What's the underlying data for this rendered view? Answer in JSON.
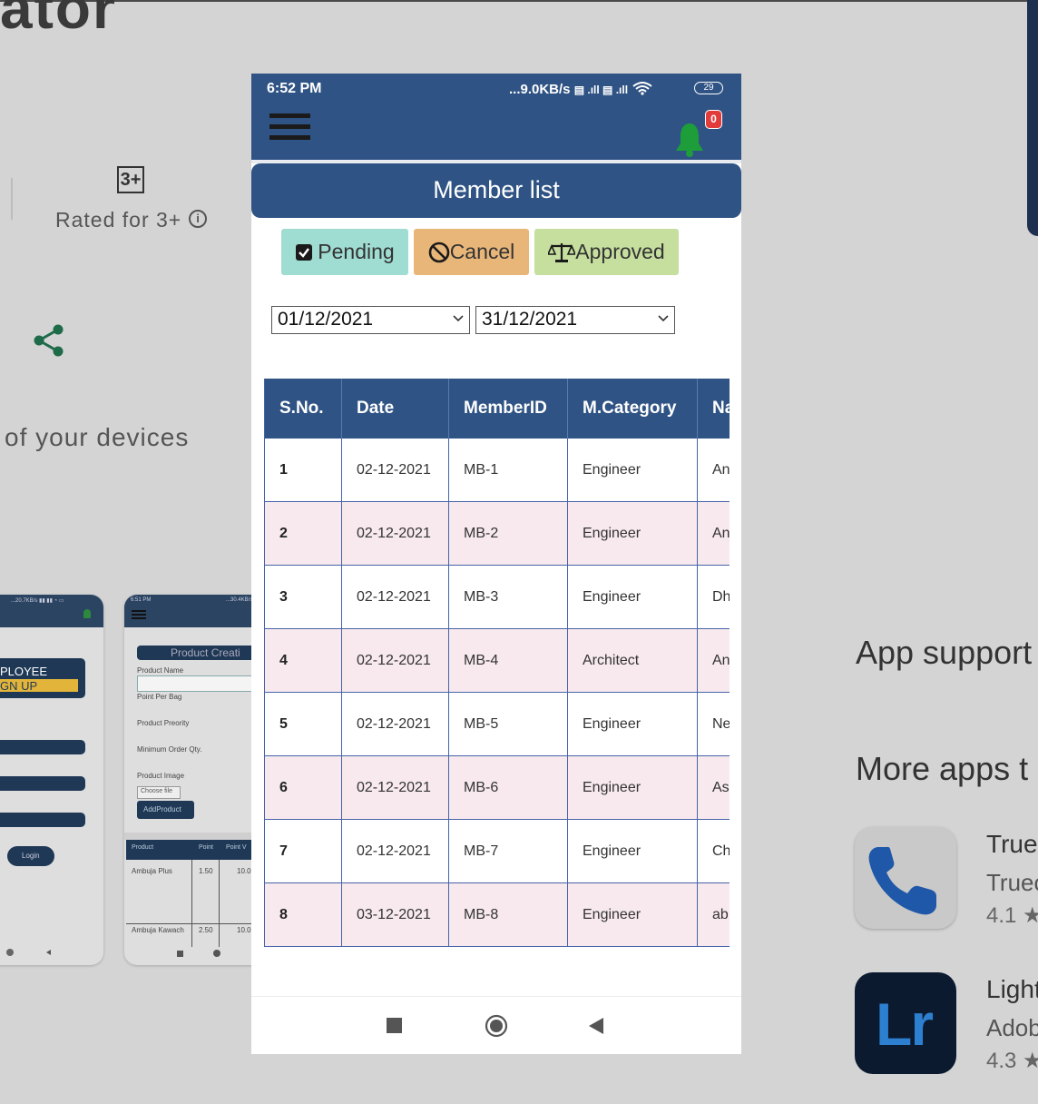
{
  "background": {
    "title_fragment": "ator",
    "rating_box": "3+",
    "rated_for": "Rated for 3+",
    "devices_text": "of your devices",
    "app_support": "App support",
    "more_apps": "More apps t",
    "apps": [
      {
        "name": "Truec",
        "developer": "Truec",
        "rating": "4.1 ★"
      },
      {
        "name": "Light",
        "developer": "Adob",
        "rating": "4.3 ★",
        "icon_text": "Lr"
      }
    ],
    "mini1": {
      "status": "...20.7KB/s ▮▮ ▮▮ ◔ ▭",
      "labels": [
        "PLOYEE",
        "GN UP",
        "Login"
      ]
    },
    "mini2": {
      "time": "6:51 PM",
      "status": "...30.4KB/s",
      "title": "Product Creati",
      "fields": [
        "Product Name",
        "Point Per Bag",
        "Product Preority",
        "Minimum Order Qty.",
        "Product Image"
      ],
      "choose_file": "Choose file",
      "add_button": "AddProduct",
      "table_headers": [
        "Product",
        "Point",
        "Point V"
      ],
      "rows": [
        [
          "Ambuja Plus",
          "1.50",
          "10.0"
        ],
        [
          "Ambuja Kawach",
          "2.50",
          "10.0"
        ]
      ]
    }
  },
  "status_bar": {
    "time": "6:52 PM",
    "network": "...9.0KB/s",
    "signal_icons": "▤ .ıll ▤ .ıll",
    "battery": "29"
  },
  "app_bar": {
    "notification_count": "0"
  },
  "page": {
    "title": "Member list"
  },
  "filters": {
    "pending": "Pending",
    "cancel": "Cancel",
    "approved": "Approved",
    "date_from": "01/12/2021",
    "date_to": "31/12/2021"
  },
  "table": {
    "headers": [
      "S.No.",
      "Date",
      "MemberID",
      "M.Category",
      "Na"
    ],
    "rows": [
      [
        "1",
        "02-12-2021",
        "MB-1",
        "Engineer",
        "An"
      ],
      [
        "2",
        "02-12-2021",
        "MB-2",
        "Engineer",
        "An"
      ],
      [
        "3",
        "02-12-2021",
        "MB-3",
        "Engineer",
        "Dh"
      ],
      [
        "4",
        "02-12-2021",
        "MB-4",
        "Architect",
        "An"
      ],
      [
        "5",
        "02-12-2021",
        "MB-5",
        "Engineer",
        "Ne"
      ],
      [
        "6",
        "02-12-2021",
        "MB-6",
        "Engineer",
        "As"
      ],
      [
        "7",
        "02-12-2021",
        "MB-7",
        "Engineer",
        "Ch"
      ],
      [
        "8",
        "03-12-2021",
        "MB-8",
        "Engineer",
        "ab"
      ]
    ]
  },
  "icons": {
    "menu": "hamburger-icon",
    "notification": "bell-icon",
    "pending": "checkbox-checked-icon",
    "cancel": "ban-icon",
    "approved": "scale-icon",
    "nav": [
      "square-stop-icon",
      "circle-home-icon",
      "triangle-back-icon"
    ]
  },
  "colors": {
    "primary": "#2f5384",
    "pending": "#9fdcd2",
    "cancel": "#e9b67a",
    "approved": "#c6df9f",
    "row_alt": "#f7e9ed",
    "badge": "#e23b3b",
    "bell": "#1e9e3a"
  }
}
